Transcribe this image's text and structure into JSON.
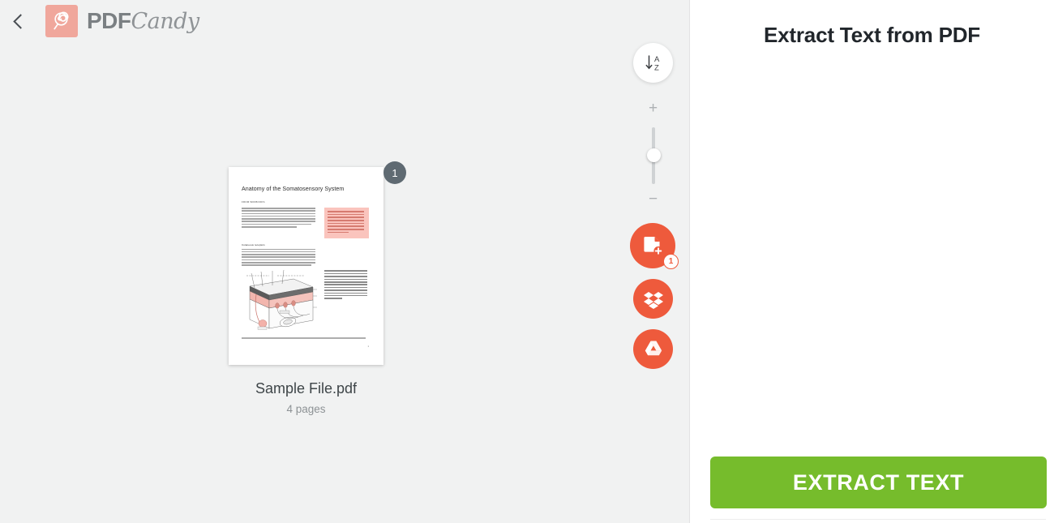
{
  "header": {
    "back_icon": "chevron-left-icon",
    "logo_icon": "lollipop-candy-icon",
    "brand_bold": "PDF",
    "brand_script": "Candy"
  },
  "workspace": {
    "sort_button": {
      "icon": "sort-az-icon",
      "arrow": "↓",
      "letter_top": "A",
      "letter_bottom": "Z"
    },
    "zoom": {
      "plus": "+",
      "minus": "−",
      "value_percent": 45
    },
    "actions": [
      {
        "name": "add-file-button",
        "icon": "document-plus-icon",
        "badge": "1"
      },
      {
        "name": "dropbox-button",
        "icon": "dropbox-icon"
      },
      {
        "name": "google-drive-button",
        "icon": "google-drive-icon"
      }
    ],
    "file": {
      "page_badge": "1",
      "name": "Sample File.pdf",
      "pages": "4 pages"
    },
    "thumbnail_document": {
      "title": "Anatomy of the Somatosensory System",
      "author": "FROM WIKIBOOKS",
      "section_heading": "Cutaneous receptors",
      "callout_text": "This is a sample document to showcase page-based formatting. It contains a chapter from a Wikibooks called Sensory Systems. None of the content has been changed in this article, but some content has been removed.",
      "figure_caption": "Figure 1: Receptors in the human skin: Mechanoreceptors can be free receptors or encapsulated. Examples for free receptors are the hair receptors at the roots of hairs. Encapsulated receptors are the Pacinian corpuscles and the receptors in the glabrous (hairless) skin: Meissner corpuscles, Ruffini corpuscles and Merkel's disks.",
      "footnote": "The following description is based on lecture notes from Laszlo Zaborszky, from Rutgers University.",
      "page_number": "1"
    }
  },
  "panel": {
    "title": "Extract Text from PDF",
    "cta_label": "EXTRACT TEXT"
  },
  "colors": {
    "accent_orange": "#ee5a3c",
    "cta_green": "#76bc2c",
    "logo_salmon": "#f0a79c",
    "workspace_bg": "#f1f2f2",
    "page_badge_gray": "#5f6a72",
    "callout_pink": "#fac4bd"
  }
}
